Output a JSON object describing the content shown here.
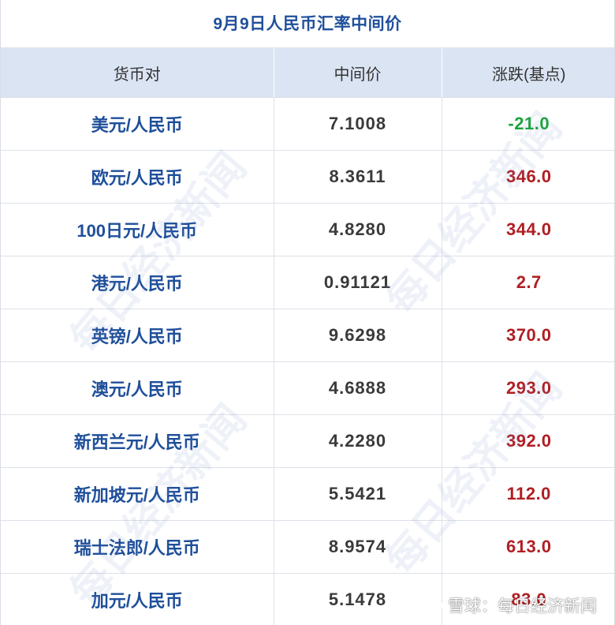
{
  "title": "9月9日人民币汇率中间价",
  "headers": [
    "货币对",
    "中间价",
    "涨跌(基点)"
  ],
  "rows": [
    {
      "pair": "美元/人民币",
      "rate": "7.1008",
      "change": "-21.0",
      "direction": "down"
    },
    {
      "pair": "欧元/人民币",
      "rate": "8.3611",
      "change": "346.0",
      "direction": "up"
    },
    {
      "pair": "100日元/人民币",
      "rate": "4.8280",
      "change": "344.0",
      "direction": "up"
    },
    {
      "pair": "港元/人民币",
      "rate": "0.91121",
      "change": "2.7",
      "direction": "up"
    },
    {
      "pair": "英镑/人民币",
      "rate": "9.6298",
      "change": "370.0",
      "direction": "up"
    },
    {
      "pair": "澳元/人民币",
      "rate": "4.6888",
      "change": "293.0",
      "direction": "up"
    },
    {
      "pair": "新西兰元/人民币",
      "rate": "4.2280",
      "change": "392.0",
      "direction": "up"
    },
    {
      "pair": "新加坡元/人民币",
      "rate": "5.5421",
      "change": "112.0",
      "direction": "up"
    },
    {
      "pair": "瑞士法郎/人民币",
      "rate": "8.9574",
      "change": "613.0",
      "direction": "up"
    },
    {
      "pair": "加元/人民币",
      "rate": "5.1478",
      "change": "83.0",
      "direction": "up"
    }
  ],
  "colors": {
    "up": "#b01e23",
    "down": "#1aa33a",
    "pair": "#1f4f9a",
    "header_bg": "#dbe4f3"
  },
  "watermark": "每日经济新闻",
  "source": {
    "icon": "snowball-icon",
    "text": "雪球：每日经济新闻"
  }
}
